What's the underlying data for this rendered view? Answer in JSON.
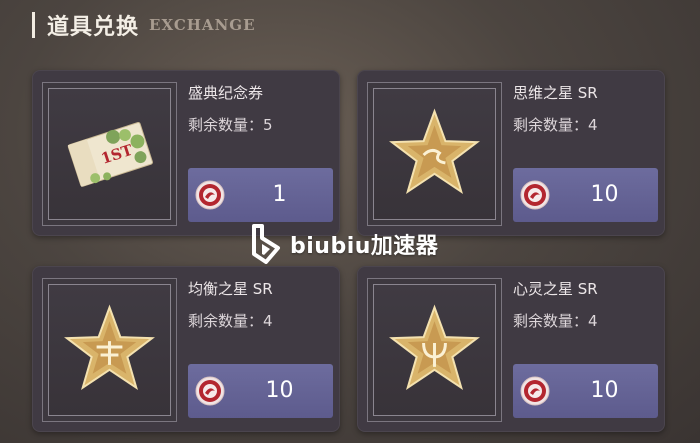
{
  "header": {
    "title": "道具兑换",
    "subtitle": "EXCHANGE"
  },
  "items": [
    {
      "name": "盛典纪念券",
      "remain_label": "剩余数量：5",
      "cost": "1",
      "icon": "ticket-icon"
    },
    {
      "name": "思维之星 SR",
      "remain_label": "剩余数量：4",
      "cost": "10",
      "icon": "star-icon"
    },
    {
      "name": "均衡之星 SR",
      "remain_label": "剩余数量：4",
      "cost": "10",
      "icon": "star-icon"
    },
    {
      "name": "心灵之星 SR",
      "remain_label": "剩余数量：4",
      "cost": "10",
      "icon": "star-icon"
    }
  ],
  "ticket": {
    "badge": "1ST"
  },
  "watermark": {
    "text": "biubiu加速器"
  },
  "colors": {
    "card": "#403a43",
    "button": "#6d6c9e",
    "gold": "#d9b46a",
    "coin": "#b3262f"
  }
}
